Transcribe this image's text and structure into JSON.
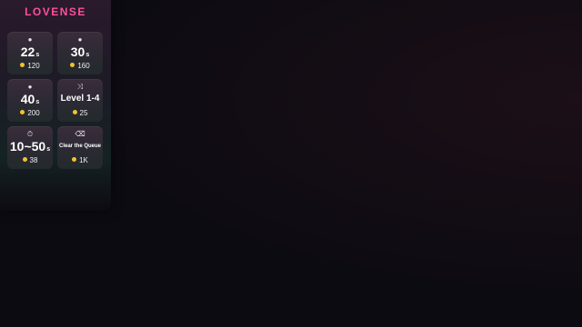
{
  "brand": {
    "logo_text": "LOVENSE",
    "accent": "#ff4f9a"
  },
  "tiles": [
    {
      "icon": "pulse-icon",
      "value": "22",
      "unit": "s",
      "cost": "120"
    },
    {
      "icon": "pulse-icon",
      "value": "30",
      "unit": "s",
      "cost": "160"
    },
    {
      "icon": "pulse-icon",
      "value": "40",
      "unit": "s",
      "cost": "200"
    },
    {
      "icon": "shuffle-icon",
      "label": "Level 1-4",
      "cost": "25"
    },
    {
      "icon": "timer-icon",
      "value": "10~50",
      "unit": "s",
      "cost": "38"
    },
    {
      "icon": "eraser-icon",
      "label": "Clear the Queue",
      "cost": "1K"
    }
  ],
  "coin_color": "#f2c230"
}
